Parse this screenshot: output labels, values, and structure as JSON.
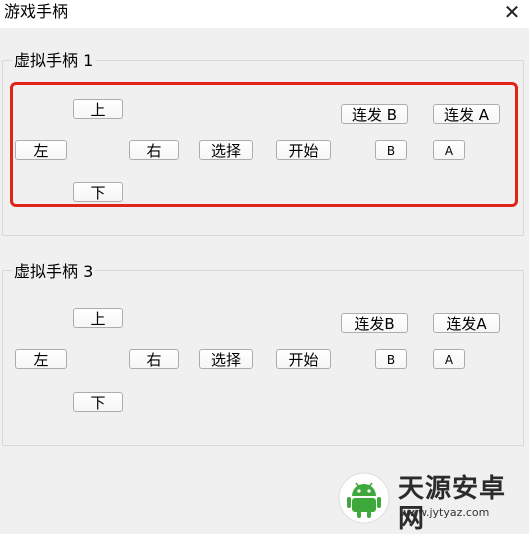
{
  "window": {
    "title": "游戏手柄",
    "close_glyph": "✕"
  },
  "gamepad1": {
    "label": "虚拟手柄 1",
    "buttons": {
      "up": "上",
      "down": "下",
      "left": "左",
      "right": "右",
      "select": "选择",
      "start": "开始",
      "turbo_b": "连发 B",
      "turbo_a": "连发 A",
      "b": "B",
      "a": "A"
    }
  },
  "gamepad3": {
    "label": "虚拟手柄 3",
    "buttons": {
      "up": "上",
      "down": "下",
      "left": "左",
      "right": "右",
      "select": "选择",
      "start": "开始",
      "turbo_b": "连发B",
      "turbo_a": "连发A",
      "b": "B",
      "a": "A"
    }
  },
  "watermark": {
    "name": "天源安卓网",
    "url": "www.jytyaz.com",
    "logo_icon": "android-robot-icon"
  },
  "colors": {
    "highlight": "#e0241b",
    "background": "#f0f0f0",
    "logo_green": "#3ea83a"
  }
}
